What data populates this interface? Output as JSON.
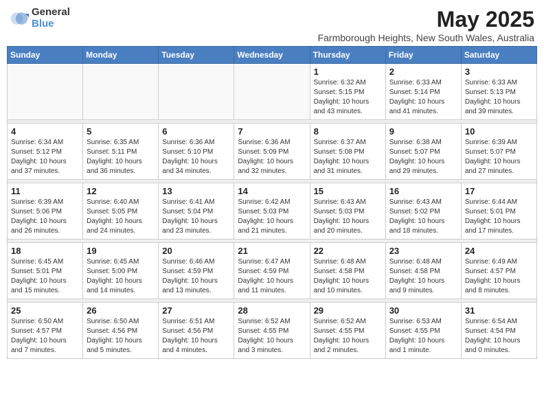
{
  "logo": {
    "general": "General",
    "blue": "Blue"
  },
  "header": {
    "month_year": "May 2025",
    "location": "Farmborough Heights, New South Wales, Australia"
  },
  "weekdays": [
    "Sunday",
    "Monday",
    "Tuesday",
    "Wednesday",
    "Thursday",
    "Friday",
    "Saturday"
  ],
  "weeks": [
    [
      {
        "day": "",
        "info": ""
      },
      {
        "day": "",
        "info": ""
      },
      {
        "day": "",
        "info": ""
      },
      {
        "day": "",
        "info": ""
      },
      {
        "day": "1",
        "info": "Sunrise: 6:32 AM\nSunset: 5:15 PM\nDaylight: 10 hours\nand 43 minutes."
      },
      {
        "day": "2",
        "info": "Sunrise: 6:33 AM\nSunset: 5:14 PM\nDaylight: 10 hours\nand 41 minutes."
      },
      {
        "day": "3",
        "info": "Sunrise: 6:33 AM\nSunset: 5:13 PM\nDaylight: 10 hours\nand 39 minutes."
      }
    ],
    [
      {
        "day": "4",
        "info": "Sunrise: 6:34 AM\nSunset: 5:12 PM\nDaylight: 10 hours\nand 37 minutes."
      },
      {
        "day": "5",
        "info": "Sunrise: 6:35 AM\nSunset: 5:11 PM\nDaylight: 10 hours\nand 36 minutes."
      },
      {
        "day": "6",
        "info": "Sunrise: 6:36 AM\nSunset: 5:10 PM\nDaylight: 10 hours\nand 34 minutes."
      },
      {
        "day": "7",
        "info": "Sunrise: 6:36 AM\nSunset: 5:09 PM\nDaylight: 10 hours\nand 32 minutes."
      },
      {
        "day": "8",
        "info": "Sunrise: 6:37 AM\nSunset: 5:08 PM\nDaylight: 10 hours\nand 31 minutes."
      },
      {
        "day": "9",
        "info": "Sunrise: 6:38 AM\nSunset: 5:07 PM\nDaylight: 10 hours\nand 29 minutes."
      },
      {
        "day": "10",
        "info": "Sunrise: 6:39 AM\nSunset: 5:07 PM\nDaylight: 10 hours\nand 27 minutes."
      }
    ],
    [
      {
        "day": "11",
        "info": "Sunrise: 6:39 AM\nSunset: 5:06 PM\nDaylight: 10 hours\nand 26 minutes."
      },
      {
        "day": "12",
        "info": "Sunrise: 6:40 AM\nSunset: 5:05 PM\nDaylight: 10 hours\nand 24 minutes."
      },
      {
        "day": "13",
        "info": "Sunrise: 6:41 AM\nSunset: 5:04 PM\nDaylight: 10 hours\nand 23 minutes."
      },
      {
        "day": "14",
        "info": "Sunrise: 6:42 AM\nSunset: 5:03 PM\nDaylight: 10 hours\nand 21 minutes."
      },
      {
        "day": "15",
        "info": "Sunrise: 6:43 AM\nSunset: 5:03 PM\nDaylight: 10 hours\nand 20 minutes."
      },
      {
        "day": "16",
        "info": "Sunrise: 6:43 AM\nSunset: 5:02 PM\nDaylight: 10 hours\nand 18 minutes."
      },
      {
        "day": "17",
        "info": "Sunrise: 6:44 AM\nSunset: 5:01 PM\nDaylight: 10 hours\nand 17 minutes."
      }
    ],
    [
      {
        "day": "18",
        "info": "Sunrise: 6:45 AM\nSunset: 5:01 PM\nDaylight: 10 hours\nand 15 minutes."
      },
      {
        "day": "19",
        "info": "Sunrise: 6:45 AM\nSunset: 5:00 PM\nDaylight: 10 hours\nand 14 minutes."
      },
      {
        "day": "20",
        "info": "Sunrise: 6:46 AM\nSunset: 4:59 PM\nDaylight: 10 hours\nand 13 minutes."
      },
      {
        "day": "21",
        "info": "Sunrise: 6:47 AM\nSunset: 4:59 PM\nDaylight: 10 hours\nand 11 minutes."
      },
      {
        "day": "22",
        "info": "Sunrise: 6:48 AM\nSunset: 4:58 PM\nDaylight: 10 hours\nand 10 minutes."
      },
      {
        "day": "23",
        "info": "Sunrise: 6:48 AM\nSunset: 4:58 PM\nDaylight: 10 hours\nand 9 minutes."
      },
      {
        "day": "24",
        "info": "Sunrise: 6:49 AM\nSunset: 4:57 PM\nDaylight: 10 hours\nand 8 minutes."
      }
    ],
    [
      {
        "day": "25",
        "info": "Sunrise: 6:50 AM\nSunset: 4:57 PM\nDaylight: 10 hours\nand 7 minutes."
      },
      {
        "day": "26",
        "info": "Sunrise: 6:50 AM\nSunset: 4:56 PM\nDaylight: 10 hours\nand 5 minutes."
      },
      {
        "day": "27",
        "info": "Sunrise: 6:51 AM\nSunset: 4:56 PM\nDaylight: 10 hours\nand 4 minutes."
      },
      {
        "day": "28",
        "info": "Sunrise: 6:52 AM\nSunset: 4:55 PM\nDaylight: 10 hours\nand 3 minutes."
      },
      {
        "day": "29",
        "info": "Sunrise: 6:52 AM\nSunset: 4:55 PM\nDaylight: 10 hours\nand 2 minutes."
      },
      {
        "day": "30",
        "info": "Sunrise: 6:53 AM\nSunset: 4:55 PM\nDaylight: 10 hours\nand 1 minute."
      },
      {
        "day": "31",
        "info": "Sunrise: 6:54 AM\nSunset: 4:54 PM\nDaylight: 10 hours\nand 0 minutes."
      }
    ]
  ]
}
